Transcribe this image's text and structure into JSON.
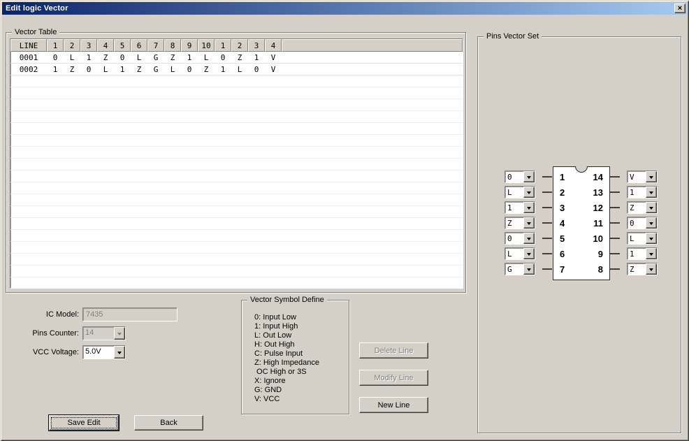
{
  "window": {
    "title": "Edit logic Vector"
  },
  "icons": {
    "close": "×"
  },
  "colors": {
    "titlebar_start": "#0a246a",
    "titlebar_end": "#a6caf0",
    "face": "#d4d0c8"
  },
  "vector_table": {
    "group_label": "Vector Table",
    "headers": [
      "LINE",
      "1",
      "2",
      "3",
      "4",
      "5",
      "6",
      "7",
      "8",
      "9",
      "10",
      "1",
      "2",
      "3",
      "4"
    ],
    "rows": [
      {
        "line": "0001",
        "values": [
          "0",
          "L",
          "1",
          "Z",
          "0",
          "L",
          "G",
          "Z",
          "1",
          "L",
          "0",
          "Z",
          "1",
          "V"
        ]
      },
      {
        "line": "0002",
        "values": [
          "1",
          "Z",
          "0",
          "L",
          "1",
          "Z",
          "G",
          "L",
          "0",
          "Z",
          "1",
          "L",
          "0",
          "V"
        ]
      }
    ]
  },
  "form": {
    "ic_model_label": "IC Model:",
    "ic_model_value": "7435",
    "pins_counter_label": "Pins Counter:",
    "pins_counter_value": "14",
    "vcc_voltage_label": "VCC Voltage:",
    "vcc_voltage_value": "5.0V"
  },
  "symbol_define": {
    "group_label": "Vector Symbol Define",
    "lines": [
      "0: Input Low",
      "1: Input High",
      "L: Out Low",
      "H: Out High",
      "C: Pulse Input",
      "Z: High Impedance",
      " OC High or 3S",
      "X: Ignore",
      "G: GND",
      "V: VCC"
    ]
  },
  "buttons": {
    "delete_line": "Delete Line",
    "modify_line": "Modify Line",
    "new_line": "New Line",
    "save_edit": "Save Edit",
    "back": "Back"
  },
  "pins_vector_set": {
    "group_label": "Pins Vector Set",
    "left_pins": [
      {
        "pin": "1",
        "value": "0"
      },
      {
        "pin": "2",
        "value": "L"
      },
      {
        "pin": "3",
        "value": "1"
      },
      {
        "pin": "4",
        "value": "Z"
      },
      {
        "pin": "5",
        "value": "0"
      },
      {
        "pin": "6",
        "value": "L"
      },
      {
        "pin": "7",
        "value": "G"
      }
    ],
    "right_pins": [
      {
        "pin": "14",
        "value": "V"
      },
      {
        "pin": "13",
        "value": "1"
      },
      {
        "pin": "12",
        "value": "Z"
      },
      {
        "pin": "11",
        "value": "0"
      },
      {
        "pin": "10",
        "value": "L"
      },
      {
        "pin": "9",
        "value": "1"
      },
      {
        "pin": "8",
        "value": "Z"
      }
    ]
  }
}
